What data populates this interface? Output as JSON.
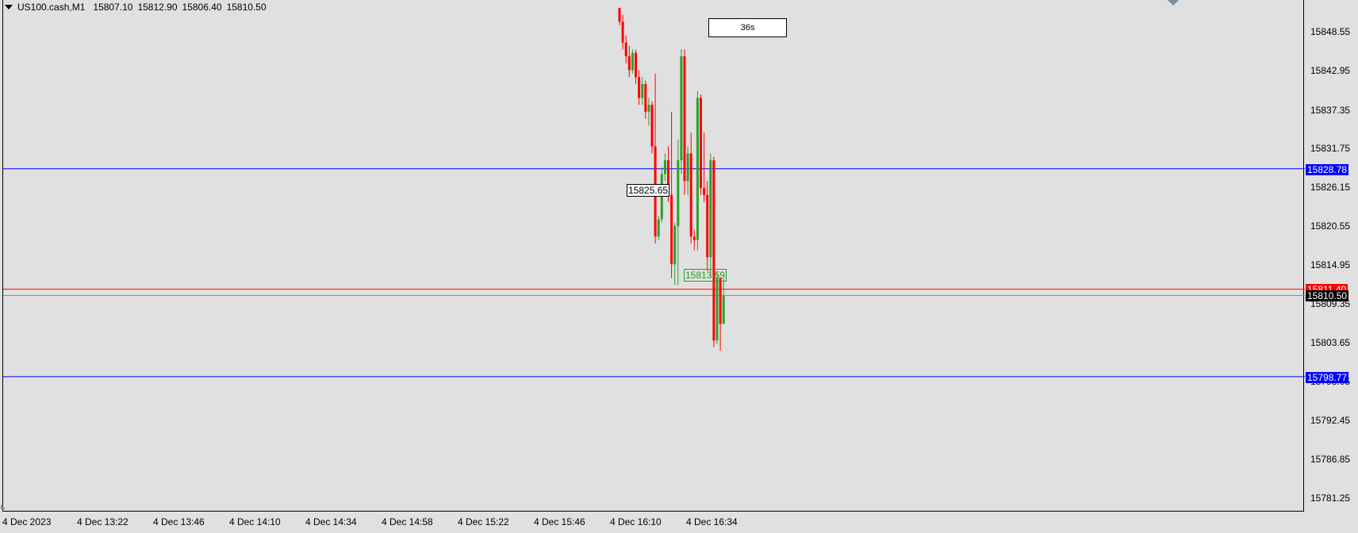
{
  "header": {
    "symbol": "US100.cash,M1",
    "open": "15807.10",
    "high": "15812.90",
    "low": "15806.40",
    "close": "15810.50"
  },
  "timer": {
    "label": "36s"
  },
  "price_axis": {
    "labels": [
      "15848.55",
      "15842.95",
      "15837.35",
      "15831.75",
      "15826.15",
      "15820.55",
      "15814.95",
      "15809.35",
      "15803.65",
      "15798.05",
      "15792.45",
      "15786.85",
      "15781.25"
    ]
  },
  "time_axis": {
    "labels": [
      "4 Dec 2023",
      "4 Dec 13:22",
      "4 Dec 13:46",
      "4 Dec 14:10",
      "4 Dec 14:34",
      "4 Dec 14:58",
      "4 Dec 15:22",
      "4 Dec 15:46",
      "4 Dec 16:10",
      "4 Dec 16:34"
    ]
  },
  "levels": {
    "upper_blue": {
      "label": "15828.78",
      "color": "#0000ff"
    },
    "lower_blue": {
      "label": "15798.77",
      "color": "#0000ff"
    },
    "ask_red": {
      "label": "15811.40",
      "color": "#ff0000"
    },
    "bid": {
      "label": "15810.50",
      "color": "#000000"
    }
  },
  "annotations": {
    "black_marker": "15825.65",
    "green_marker": "15813.59"
  },
  "colors": {
    "bull": "#2aa02a",
    "bear": "#ff0000",
    "background": "#e0e0e0"
  },
  "icons": {
    "header_dropdown": "triangle-down-icon",
    "scroll_marker": "triangle-down-icon",
    "corner": "triangle-icon"
  },
  "chart_data": {
    "type": "candlestick",
    "ohlc": [
      [
        15852,
        15852,
        15849.5,
        15850
      ],
      [
        15850,
        15851,
        15846,
        15847
      ],
      [
        15847,
        15848,
        15844,
        15845
      ],
      [
        15845,
        15846.5,
        15842,
        15843
      ],
      [
        15843,
        15846,
        15842.5,
        15845.5
      ],
      [
        15845.5,
        15846,
        15841,
        15842
      ],
      [
        15842,
        15843,
        15838,
        15839
      ],
      [
        15839,
        15842,
        15838,
        15841
      ],
      [
        15841,
        15841.5,
        15836,
        15837
      ],
      [
        15837,
        15839,
        15835,
        15838
      ],
      [
        15838,
        15838.5,
        15831,
        15832
      ],
      [
        15832,
        15842.5,
        15818,
        15819
      ],
      [
        15819,
        15822,
        15818.5,
        15821.5
      ],
      [
        15821.5,
        15829,
        15821,
        15828
      ],
      [
        15828,
        15831,
        15827,
        15830
      ],
      [
        15830,
        15832,
        15824,
        15825
      ],
      [
        15825,
        15837,
        15813,
        15815
      ],
      [
        15815,
        15821,
        15812,
        15820.5
      ],
      [
        15820.5,
        15833,
        15812,
        15830
      ],
      [
        15830,
        15846,
        15828,
        15845
      ],
      [
        15845,
        15846,
        15825,
        15827
      ],
      [
        15827,
        15832,
        15825,
        15831
      ],
      [
        15831,
        15834,
        15818,
        15819
      ],
      [
        15819,
        15820,
        15817,
        15818.5
      ],
      [
        15818.5,
        15840,
        15817,
        15839
      ],
      [
        15839,
        15839.5,
        15825,
        15826
      ],
      [
        15826,
        15834,
        15824,
        15825
      ],
      [
        15825,
        15827,
        15814,
        15816
      ],
      [
        15816,
        15831,
        15813,
        15830
      ],
      [
        15830,
        15830.5,
        15803,
        15804
      ],
      [
        15804,
        15814,
        15803.5,
        15813
      ],
      [
        15813,
        15813,
        15802.5,
        15806.4
      ],
      [
        15806.4,
        15812.9,
        15806.4,
        15810.5
      ]
    ]
  }
}
